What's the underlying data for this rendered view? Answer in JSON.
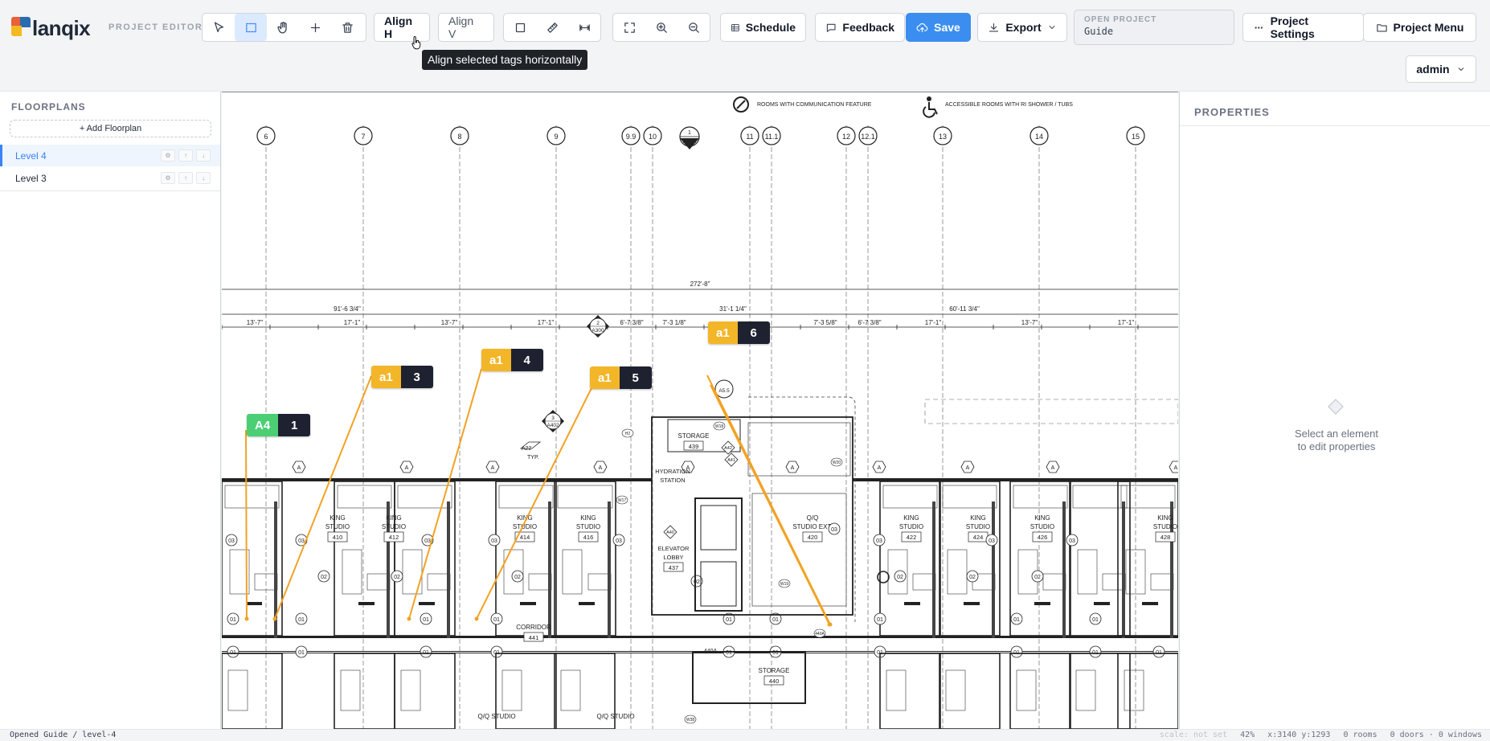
{
  "app": {
    "logo_text": "lanqix",
    "subtitle": "PROJECT EDITOR"
  },
  "toolbar": {
    "align_h": "Align H",
    "align_v": "Align V",
    "schedule": "Schedule",
    "feedback": "Feedback",
    "save": "Save",
    "export": "Export",
    "project_settings": "Project Settings",
    "project_menu": "Project Menu",
    "tooltip": "Align selected tags horizontally"
  },
  "open_project": {
    "label": "OPEN PROJECT",
    "value": "Guide"
  },
  "user": {
    "name": "admin"
  },
  "sidebar": {
    "title": "FLOORPLANS",
    "add_label": "+ Add Floorplan",
    "items": [
      {
        "label": "Level 4",
        "active": true
      },
      {
        "label": "Level 3",
        "active": false
      }
    ],
    "ctrl_icons": [
      "⚙",
      "↑",
      "↓"
    ]
  },
  "properties": {
    "title": "PROPERTIES",
    "empty_line1": "Select an element",
    "empty_line2": "to edit properties"
  },
  "status": {
    "left": "Opened Guide / level-4",
    "scale": "scale: not set",
    "zoom": "42%",
    "coords": "x:3140 y:1293",
    "rooms": "0 rooms",
    "doors_windows": "0 doors · 0 windows"
  },
  "colors": {
    "accent": "#3b8ef0",
    "tag_yellow": "#f2b628",
    "tag_green": "#4ccf74",
    "tag_dark": "#1e2230"
  },
  "tags": [
    {
      "code": "A4",
      "number": "1",
      "color": "green"
    },
    {
      "code": "a1",
      "number": "3",
      "color": "yellow"
    },
    {
      "code": "a1",
      "number": "4",
      "color": "yellow"
    },
    {
      "code": "a1",
      "number": "5",
      "color": "yellow"
    },
    {
      "code": "a1",
      "number": "6",
      "color": "yellow"
    }
  ],
  "drawing": {
    "legend_comm": "ROOMS WITH COMMUNICATION FEATURE",
    "legend_access": "ACCESSIBLE ROOMS WITH RI SHOWER / TUBS",
    "grid_labels": [
      "6",
      "7",
      "8",
      "9",
      "9.9",
      "10",
      "11",
      "11.1",
      "12",
      "12.1",
      "13",
      "14",
      "15"
    ],
    "dim_overall": "272'-8\"",
    "dim_groups": [
      "91'-6 3/4\"",
      "31'-1 1/4\"",
      "60'-11 3/4\""
    ],
    "dim_bays": [
      "13'-7\"",
      "17'-1\"",
      "13'-7\"",
      "17'-1\"",
      "6'-7 3/8\"",
      "7'-3 1/8\"",
      "7'-3 5/8\"",
      "6'-7 3/8\"",
      "17'-1\"",
      "13'-7\"",
      "17'-1\""
    ],
    "rooms": [
      {
        "name": "KING STUDIO",
        "num": "410"
      },
      {
        "name": "KING STUDIO",
        "num": "412"
      },
      {
        "name": "KING STUDIO",
        "num": "414"
      },
      {
        "name": "KING STUDIO",
        "num": "416"
      },
      {
        "name": "Q/Q STUDIO EXT.",
        "num": "420"
      },
      {
        "name": "KING STUDIO",
        "num": "422"
      },
      {
        "name": "KING STUDIO",
        "num": "424"
      },
      {
        "name": "KING STUDIO",
        "num": "426"
      },
      {
        "name": "KING STUDIO",
        "num": "428"
      }
    ],
    "core": {
      "storage": "STORAGE",
      "storage_num": "439",
      "hydration": "HYDRATION STATION",
      "elevator": "ELEVATOR LOBBY",
      "elevator_num": "437",
      "corridor": "CORRIDOR",
      "corridor_num": "441",
      "storage2": "STORAGE",
      "storage2_num": "440",
      "qq_studio": "Q/Q STUDIO"
    },
    "section_marks": [
      {
        "top": "1",
        "bottom": "A201"
      },
      {
        "top": "2",
        "bottom": "A300"
      },
      {
        "top": "3",
        "bottom": "A402"
      },
      {
        "top": "",
        "bottom": "A5.5"
      }
    ],
    "notes": [
      "A22",
      "TYP."
    ],
    "callouts": [
      "01",
      "02",
      "03",
      "A",
      "A40",
      "A42",
      "A41",
      "H2",
      "W17",
      "W18",
      "W19",
      "W20",
      "W38",
      "440A"
    ]
  }
}
